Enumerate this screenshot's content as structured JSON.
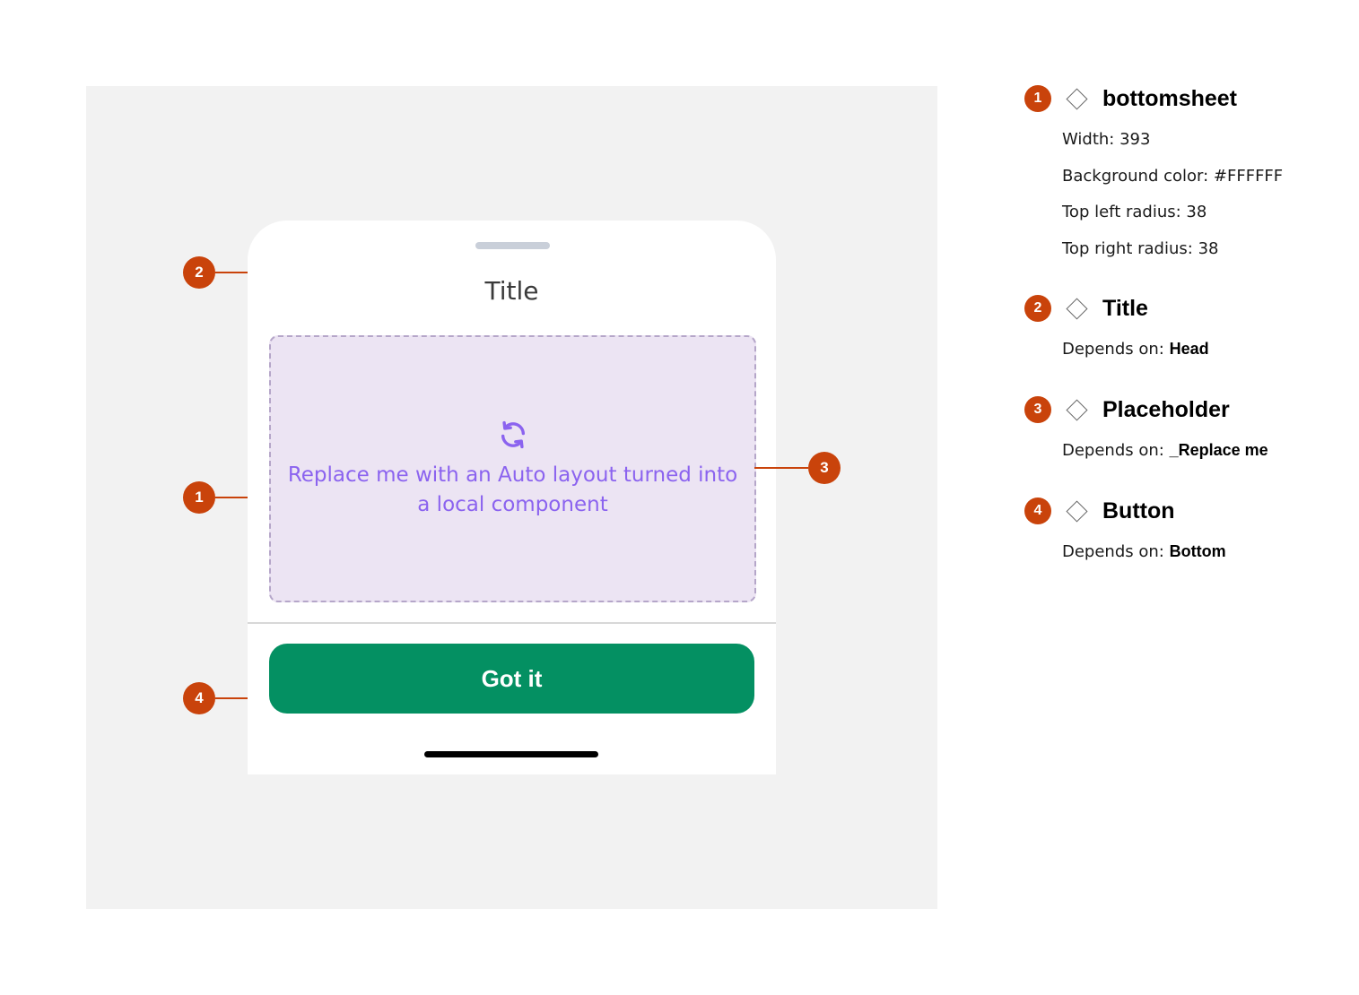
{
  "sheet": {
    "title": "Title",
    "placeholder_text": "Replace me with an Auto layout turned into a local component",
    "placeholder_icon": "refresh-icon",
    "button_label": "Got it"
  },
  "callouts": [
    "1",
    "2",
    "3",
    "4"
  ],
  "specs": [
    {
      "number": "1",
      "name": "bottomsheet",
      "props": [
        {
          "label": "Width:",
          "value": "393"
        },
        {
          "label": "Background color:",
          "value": "#FFFFFF"
        },
        {
          "label": "Top left radius:",
          "value": "38"
        },
        {
          "label": "Top right radius:",
          "value": "38"
        }
      ]
    },
    {
      "number": "2",
      "name": "Title",
      "depends_label": "Depends on:",
      "depends_value": "Head"
    },
    {
      "number": "3",
      "name": "Placeholder",
      "depends_label": "Depends on:",
      "depends_value": "_Replace me"
    },
    {
      "number": "4",
      "name": "Button",
      "depends_label": "Depends on:",
      "depends_value": "Bottom"
    }
  ],
  "colors": {
    "accent": "#C9430B",
    "button": "#049062",
    "placeholder_bg": "#ECE4F3",
    "placeholder_text": "#8B63EF"
  }
}
